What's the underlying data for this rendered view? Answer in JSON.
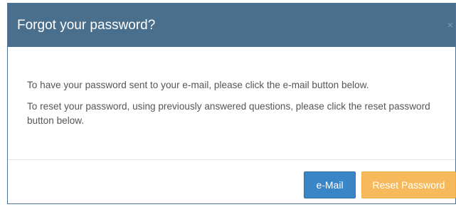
{
  "dialog": {
    "title": "Forgot your password?",
    "close_label": "×",
    "body": {
      "paragraph_email": "To have your password sent to your e-mail, please click the e-mail button below.",
      "paragraph_reset": "To reset your password, using previously answered questions, please click the reset password button below."
    },
    "footer": {
      "email_button_label": "e-Mail",
      "reset_button_label": "Reset Password"
    }
  },
  "colors": {
    "header_bg": "#4a6f8c",
    "email_button": "#3a85c6",
    "reset_button": "#f6ba5c"
  }
}
